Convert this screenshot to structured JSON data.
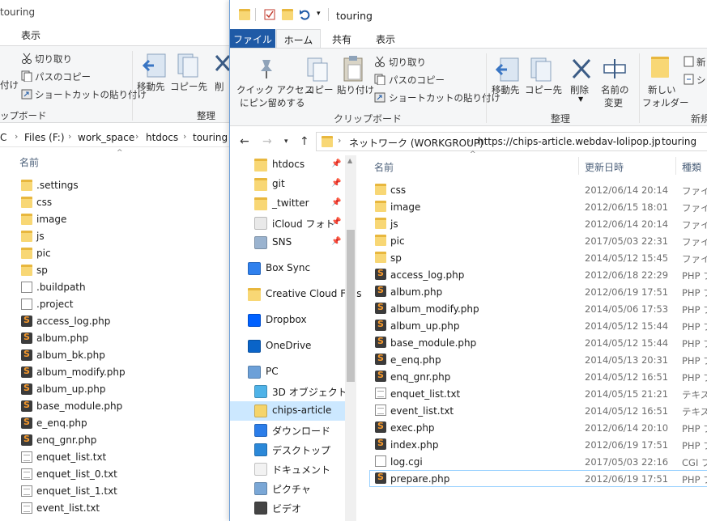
{
  "back_window": {
    "title": "touring",
    "tab_view": "表示",
    "ribbon": {
      "cut": "切り取り",
      "copy_path": "パスのコピー",
      "paste_shortcut": "ショートカットの貼り付け",
      "paste_partial": "付け",
      "clipboard_partial": "ップボード",
      "move_to": "移動先",
      "copy_to": "コピー先",
      "delete_partial": "削",
      "organize": "整理"
    },
    "address": [
      "C",
      "Files (F:)",
      "work_space",
      "htdocs",
      "touring"
    ],
    "column_name": "名前",
    "files": [
      {
        "name": ".settings",
        "icon": "folder-icon"
      },
      {
        "name": "css",
        "icon": "folder-icon"
      },
      {
        "name": "image",
        "icon": "folder-icon"
      },
      {
        "name": "js",
        "icon": "folder-icon"
      },
      {
        "name": "pic",
        "icon": "folder-icon"
      },
      {
        "name": "sp",
        "icon": "folder-icon"
      },
      {
        "name": ".buildpath",
        "icon": "file-icon"
      },
      {
        "name": ".project",
        "icon": "file-icon"
      },
      {
        "name": "access_log.php",
        "icon": "php-icon"
      },
      {
        "name": "album.php",
        "icon": "php-icon"
      },
      {
        "name": "album_bk.php",
        "icon": "php-icon"
      },
      {
        "name": "album_modify.php",
        "icon": "php-icon"
      },
      {
        "name": "album_up.php",
        "icon": "php-icon"
      },
      {
        "name": "base_module.php",
        "icon": "php-icon"
      },
      {
        "name": "e_enq.php",
        "icon": "php-icon"
      },
      {
        "name": "enq_gnr.php",
        "icon": "php-icon"
      },
      {
        "name": "enquet_list.txt",
        "icon": "text-icon"
      },
      {
        "name": "enquet_list_0.txt",
        "icon": "text-icon"
      },
      {
        "name": "enquet_list_1.txt",
        "icon": "text-icon"
      },
      {
        "name": "event_list.txt",
        "icon": "text-icon"
      }
    ]
  },
  "front_window": {
    "title": "touring",
    "tabs": {
      "file": "ファイル",
      "home": "ホーム",
      "share": "共有",
      "view": "表示"
    },
    "ribbon": {
      "pin_quick_access_1": "クイック アクセス",
      "pin_quick_access_2": "にピン留めする",
      "copy": "コピー",
      "paste": "貼り付け",
      "cut": "切り取り",
      "copy_path": "パスのコピー",
      "paste_shortcut": "ショートカットの貼り付け",
      "clipboard": "クリップボード",
      "move_to": "移動先",
      "copy_to": "コピー先",
      "delete": "削除",
      "rename_1": "名前の",
      "rename_2": "変更",
      "organize": "整理",
      "new_folder_1": "新しい",
      "new_folder_2": "フォルダー",
      "new_partial_1": "新",
      "new_partial_2": "シ",
      "new_group_partial": "新規"
    },
    "address": [
      "ネットワーク (WORKGROUP)",
      "https://chips-article.webdav-lolipop.jp",
      "touring"
    ],
    "nav": [
      {
        "name": "htdocs",
        "icon": "folder-icon",
        "pinned": true
      },
      {
        "name": "git",
        "icon": "folder-icon",
        "pinned": true
      },
      {
        "name": "_twitter",
        "icon": "folder-icon",
        "pinned": true
      },
      {
        "name": "iCloud フォト",
        "icon": "icloud-photos-icon",
        "pinned": true
      },
      {
        "name": "SNS",
        "icon": "network-folder-icon",
        "pinned": true
      },
      {
        "name": "Box Sync",
        "icon": "box-icon",
        "pinned": false
      },
      {
        "name": "Creative Cloud Files",
        "icon": "folder-icon",
        "pinned": false
      },
      {
        "name": "Dropbox",
        "icon": "dropbox-icon",
        "pinned": false
      },
      {
        "name": "OneDrive",
        "icon": "onedrive-icon",
        "pinned": false
      },
      {
        "name": "PC",
        "icon": "pc-icon",
        "pinned": false
      },
      {
        "name": "3D オブジェクト",
        "icon": "3d-objects-icon",
        "pinned": false
      },
      {
        "name": "chips-article",
        "icon": "network-drive-icon",
        "pinned": false
      },
      {
        "name": "ダウンロード",
        "icon": "download-icon",
        "pinned": false
      },
      {
        "name": "デスクトップ",
        "icon": "desktop-icon",
        "pinned": false
      },
      {
        "name": "ドキュメント",
        "icon": "documents-icon",
        "pinned": false
      },
      {
        "name": "ピクチャ",
        "icon": "pictures-icon",
        "pinned": false
      },
      {
        "name": "ビデオ",
        "icon": "videos-icon",
        "pinned": false
      }
    ],
    "columns": {
      "name": "名前",
      "date": "更新日時",
      "type": "種類"
    },
    "files": [
      {
        "name": "css",
        "date": "2012/06/14 20:14",
        "type": "ファイル",
        "icon": "folder-icon"
      },
      {
        "name": "image",
        "date": "2012/06/15 18:01",
        "type": "ファイル",
        "icon": "folder-icon"
      },
      {
        "name": "js",
        "date": "2012/06/14 20:14",
        "type": "ファイル",
        "icon": "folder-icon"
      },
      {
        "name": "pic",
        "date": "2017/05/03 22:31",
        "type": "ファイル",
        "icon": "folder-icon"
      },
      {
        "name": "sp",
        "date": "2014/05/12 15:45",
        "type": "ファイル",
        "icon": "folder-icon"
      },
      {
        "name": "access_log.php",
        "date": "2012/06/18 22:29",
        "type": "PHP フ",
        "icon": "php-icon"
      },
      {
        "name": "album.php",
        "date": "2012/06/19 17:51",
        "type": "PHP フ",
        "icon": "php-icon"
      },
      {
        "name": "album_modify.php",
        "date": "2014/05/06 17:53",
        "type": "PHP フ",
        "icon": "php-icon"
      },
      {
        "name": "album_up.php",
        "date": "2014/05/12 15:44",
        "type": "PHP フ",
        "icon": "php-icon"
      },
      {
        "name": "base_module.php",
        "date": "2014/05/12 15:44",
        "type": "PHP フ",
        "icon": "php-icon"
      },
      {
        "name": "e_enq.php",
        "date": "2014/05/13 20:31",
        "type": "PHP フ",
        "icon": "php-icon"
      },
      {
        "name": "enq_gnr.php",
        "date": "2014/05/12 16:51",
        "type": "PHP フ",
        "icon": "php-icon"
      },
      {
        "name": "enquet_list.txt",
        "date": "2014/05/15 21:21",
        "type": "テキスト",
        "icon": "text-icon"
      },
      {
        "name": "event_list.txt",
        "date": "2014/05/12 16:51",
        "type": "テキスト",
        "icon": "text-icon"
      },
      {
        "name": "exec.php",
        "date": "2012/06/14 20:10",
        "type": "PHP フ",
        "icon": "php-icon"
      },
      {
        "name": "index.php",
        "date": "2012/06/19 17:51",
        "type": "PHP フ",
        "icon": "php-icon"
      },
      {
        "name": "log.cgi",
        "date": "2017/05/03 22:16",
        "type": "CGI フ",
        "icon": "file-icon"
      },
      {
        "name": "prepare.php",
        "date": "2012/06/19 17:51",
        "type": "PHP フ",
        "icon": "php-icon"
      }
    ]
  },
  "colors": {
    "accent": "#1f5aa6",
    "selection": "#cce8ff",
    "folder": "#f8d775"
  }
}
